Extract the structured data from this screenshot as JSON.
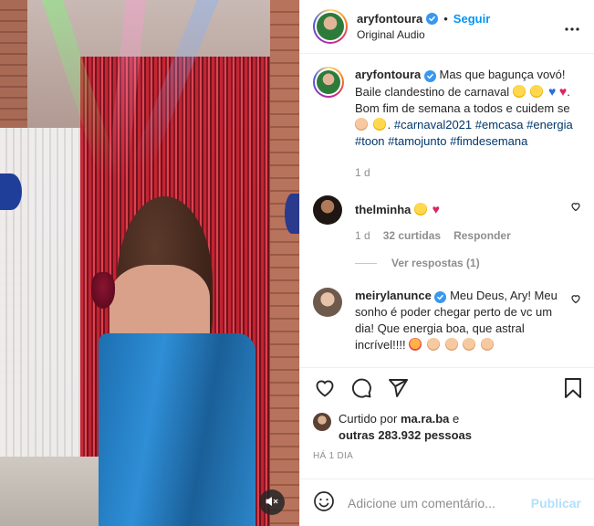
{
  "post": {
    "author": {
      "username": "aryfontoura",
      "verified": true,
      "follow_label": "Seguir",
      "separator": "•",
      "audio": "Original Audio"
    },
    "caption": {
      "username": "aryfontoura",
      "text_1": "Mas que bagunça vovó! Baile clandestino de carnaval",
      "text_2": ". Bom fim de semana a todos e cuidem se",
      "hashtags_1": "#carnaval2021",
      "hashtags_2": "#emcasa #energia #toon #tamojunto",
      "hashtags_3": "#fimdesemana",
      "age": "1 d"
    },
    "comments": [
      {
        "username": "thelminha",
        "age": "1 d",
        "likes": "32 curtidas",
        "reply_label": "Responder",
        "view_replies": "Ver respostas (1)"
      },
      {
        "username": "meirylanunce",
        "verified": true,
        "text": "Meu Deus, Ary! Meu sonho é poder chegar perto de vc um dia! Que energia boa, que astral incrível!!!!"
      }
    ],
    "liked_by": {
      "prefix": "Curtido por",
      "user": "ma.ra.ba",
      "connector": "e",
      "others": "outras 283.932 pessoas"
    },
    "timestamp": "HÁ 1 DIA",
    "add_comment": {
      "placeholder": "Adicione um comentário...",
      "publish_label": "Publicar"
    },
    "icons": {
      "more": "more-options-icon",
      "like": "heart-icon",
      "comment": "comment-icon",
      "share": "share-icon",
      "save": "bookmark-icon",
      "emoji": "emoji-icon",
      "mute": "muted-speaker-icon"
    },
    "colors": {
      "link_blue": "#0095f6",
      "hashtag": "#00376b",
      "muted_text": "#8e8e8e",
      "verified": "#3897f0",
      "publish_disabled": "#b2dffc"
    }
  }
}
